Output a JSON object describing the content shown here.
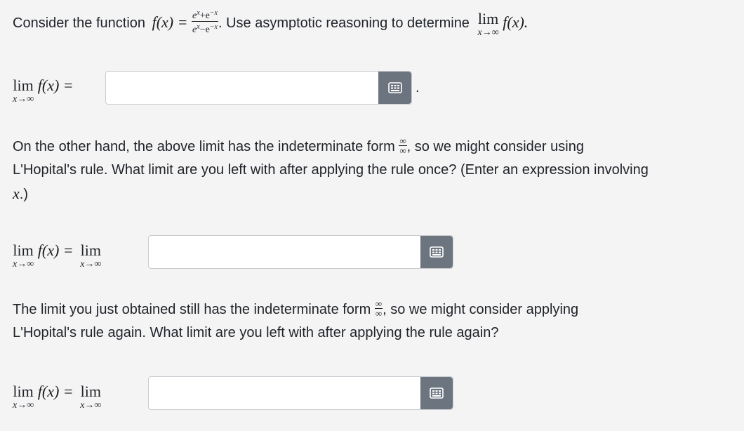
{
  "question": {
    "intro_pre": "Consider the function",
    "fx": "f(x) =",
    "frac_num": "e",
    "frac_num_sup1": "x",
    "frac_num_mid": "+e",
    "frac_num_sup2": "−x",
    "frac_den": "e",
    "frac_den_sup1": "x",
    "frac_den_mid": "−e",
    "frac_den_sup2": "−x",
    "intro_post": ". Use asymptotic reasoning to determine",
    "lim_word": "lim",
    "lim_sub": "x→∞",
    "lim_target": "f(x)."
  },
  "part1": {
    "lim_word": "lim",
    "lim_sub": "x→∞",
    "expr": "f(x) =",
    "answer_value": "",
    "trailing": "."
  },
  "paragraph2": {
    "line1_pre": "On the other hand, the above limit has the indeterminate form",
    "form_num": "∞",
    "form_den": "∞",
    "line1_post": ", so we might consider using",
    "line2": "L'Hopital's rule. What limit are you left with after applying the rule once? (Enter an expression involving",
    "line3_var": "x",
    "line3_post": ".)"
  },
  "part2": {
    "lim_word": "lim",
    "lim_sub": "x→∞",
    "expr": "f(x) =",
    "lim2_word": "lim",
    "lim2_sub": "x→∞",
    "answer_value": ""
  },
  "paragraph3": {
    "line1_pre": "The limit you just obtained still has the indeterminate form",
    "form_num": "∞",
    "form_den": "∞",
    "line1_post": ", so we might consider applying",
    "line2": "L'Hopital's rule again. What limit are you left with after applying the rule again?"
  },
  "part3": {
    "lim_word": "lim",
    "lim_sub": "x→∞",
    "expr": "f(x) =",
    "lim2_word": "lim",
    "lim2_sub": "x→∞",
    "answer_value": ""
  },
  "icons": {
    "keyboard": "math-keyboard-icon"
  },
  "colors": {
    "button_bg": "#6c7480",
    "input_border": "#c9ccd1",
    "page_bg": "#f4f4f5"
  }
}
